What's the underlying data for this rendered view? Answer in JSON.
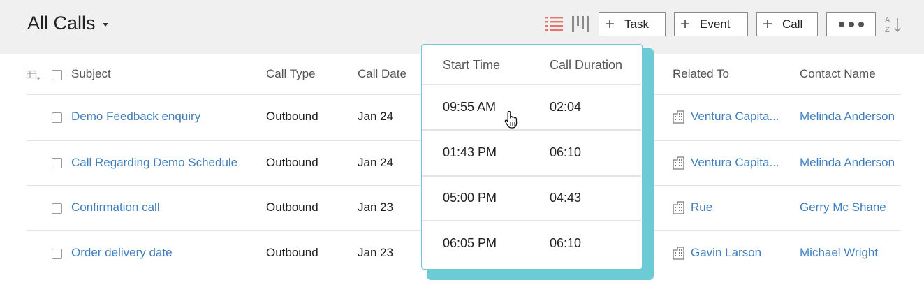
{
  "header": {
    "title": "All Calls",
    "buttons": {
      "task": "Task",
      "event": "Event",
      "call": "Call"
    },
    "active_view_color": "#e8736a"
  },
  "columns": {
    "subject": "Subject",
    "call_type": "Call Type",
    "call_date": "Call Date",
    "related_to": "Related To",
    "contact_name": "Contact Name"
  },
  "rows": [
    {
      "subject": "Demo Feedback enquiry",
      "call_type": "Outbound",
      "call_date": "Jan 24",
      "related_to": "Ventura Capita...",
      "contact_name": "Melinda Anderson"
    },
    {
      "subject": "Call Regarding Demo Schedule",
      "call_type": "Outbound",
      "call_date": "Jan 24",
      "related_to": "Ventura Capita...",
      "contact_name": "Melinda Anderson"
    },
    {
      "subject": "Confirmation call",
      "call_type": "Outbound",
      "call_date": "Jan 23",
      "related_to": "Rue",
      "contact_name": "Gerry Mc Shane"
    },
    {
      "subject": "Order delivery date",
      "call_type": "Outbound",
      "call_date": "Jan 23",
      "related_to": "Gavin Larson",
      "contact_name": "Michael Wright"
    }
  ],
  "popup": {
    "headers": {
      "start_time": "Start Time",
      "call_duration": "Call Duration"
    },
    "rows": [
      {
        "start_time": "09:55 AM",
        "call_duration": "02:04"
      },
      {
        "start_time": "01:43 PM",
        "call_duration": "06:10"
      },
      {
        "start_time": "05:00 PM",
        "call_duration": "04:43"
      },
      {
        "start_time": "06:05 PM",
        "call_duration": "06:10"
      }
    ],
    "accent_color": "#6ccbd4"
  },
  "colors": {
    "link": "#3f7fbf",
    "topbar_bg": "#f0f0f0"
  }
}
